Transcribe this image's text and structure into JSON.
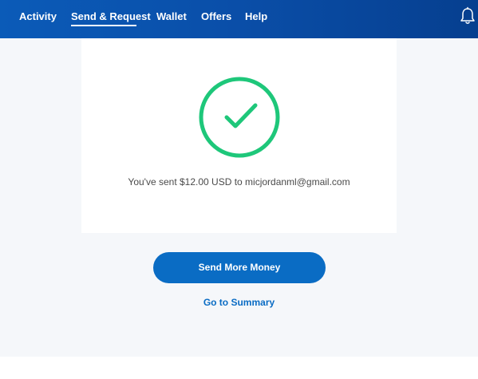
{
  "nav": {
    "items": [
      {
        "label": "Activity"
      },
      {
        "label": "Send & Request"
      },
      {
        "label": "Wallet"
      },
      {
        "label": "Offers"
      },
      {
        "label": "Help"
      }
    ],
    "active_index": 1,
    "notification_icon": "bell-icon"
  },
  "confirmation": {
    "icon": "checkmark-circle-icon",
    "message": "You've sent $12.00 USD to micjordanml@gmail.com"
  },
  "actions": {
    "send_more_label": "Send More Money",
    "summary_link_label": "Go to Summary"
  },
  "colors": {
    "nav_background": "#0a4ea8",
    "accent_blue": "#0a6cc4",
    "success_green": "#1ec77a",
    "content_background": "#f5f7fa"
  }
}
